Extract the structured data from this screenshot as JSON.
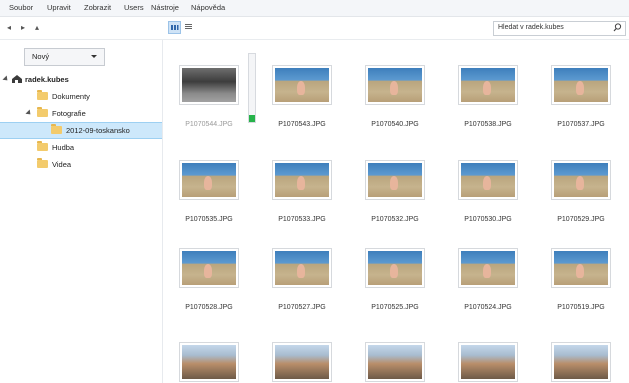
{
  "menu": [
    "Soubor",
    "Upravit",
    "Zobrazit",
    "Users",
    "Nástroje",
    "Nápověda"
  ],
  "nav": {
    "back_icon": "back-arrow-icon",
    "forward_icon": "forward-arrow-icon",
    "up_icon": "up-arrow-icon"
  },
  "view": {
    "grid_icon": "grid-view-icon",
    "list_icon": "list-view-icon",
    "active": "grid"
  },
  "search": {
    "placeholder": "Hledat v radek.kubes",
    "icon": "search-icon"
  },
  "sidebar": {
    "new_button": "Nový",
    "tree": [
      {
        "label": "radek.kubes",
        "level": 0,
        "bold": true,
        "icon": "home-icon",
        "expanded": true
      },
      {
        "label": "Dokumenty",
        "level": 1,
        "icon": "folder-icon"
      },
      {
        "label": "Fotografie",
        "level": 1,
        "icon": "folder-icon",
        "expanded": true
      },
      {
        "label": "2012-09-toskansko",
        "level": 2,
        "icon": "folder-icon",
        "selected": true
      },
      {
        "label": "Hudba",
        "level": 1,
        "icon": "folder-icon"
      },
      {
        "label": "Videa",
        "level": 1,
        "icon": "folder-icon"
      }
    ]
  },
  "upload_progress": 0.1,
  "files": [
    {
      "name": "P1070544.JPG",
      "kind": "bw",
      "dim": true
    },
    {
      "name": "P1070543.JPG",
      "kind": "sand"
    },
    {
      "name": "P1070540.JPG",
      "kind": "sand"
    },
    {
      "name": "P1070538.JPG",
      "kind": "sand"
    },
    {
      "name": "P1070537.JPG",
      "kind": "sand"
    },
    {
      "name": "P1070535.JPG",
      "kind": "sand"
    },
    {
      "name": "P1070533.JPG",
      "kind": "sand"
    },
    {
      "name": "P1070532.JPG",
      "kind": "sand"
    },
    {
      "name": "P1070530.JPG",
      "kind": "sand"
    },
    {
      "name": "P1070529.JPG",
      "kind": "sand"
    },
    {
      "name": "P1070528.JPG",
      "kind": "sand"
    },
    {
      "name": "P1070527.JPG",
      "kind": "sand"
    },
    {
      "name": "P1070525.JPG",
      "kind": "sand"
    },
    {
      "name": "P1070524.JPG",
      "kind": "sand"
    },
    {
      "name": "P1070519.JPG",
      "kind": "sand"
    },
    {
      "name": "",
      "kind": "street"
    },
    {
      "name": "",
      "kind": "street"
    },
    {
      "name": "",
      "kind": "street"
    },
    {
      "name": "",
      "kind": "street"
    },
    {
      "name": "",
      "kind": "street"
    }
  ]
}
